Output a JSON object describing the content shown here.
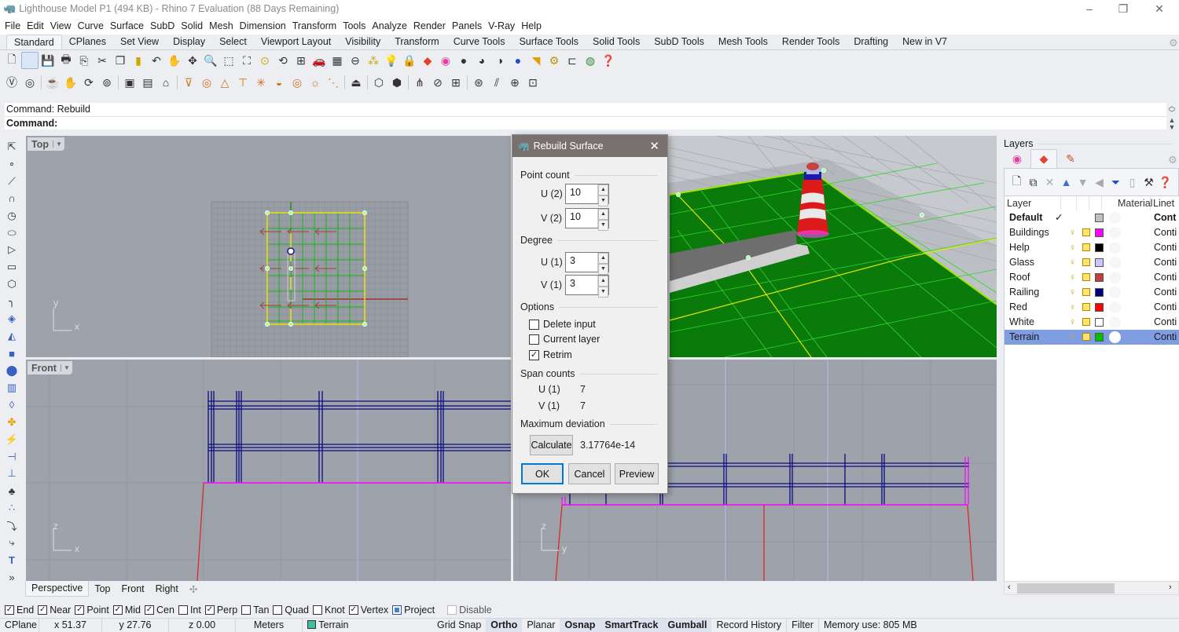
{
  "window": {
    "title": "Lighthouse Model P1 (494 KB) - Rhino 7 Evaluation (88 Days Remaining)",
    "minimize": "–",
    "restore": "❐",
    "close": "✕"
  },
  "menu": [
    "File",
    "Edit",
    "View",
    "Curve",
    "Surface",
    "SubD",
    "Solid",
    "Mesh",
    "Dimension",
    "Transform",
    "Tools",
    "Analyze",
    "Render",
    "Panels",
    "V-Ray",
    "Help"
  ],
  "toolbar_tabs": [
    "Standard",
    "CPlanes",
    "Set View",
    "Display",
    "Select",
    "Viewport Layout",
    "Visibility",
    "Transform",
    "Curve Tools",
    "Surface Tools",
    "Solid Tools",
    "SubD Tools",
    "Mesh Tools",
    "Render Tools",
    "Drafting",
    "New in V7"
  ],
  "active_toolbar_tab": "Standard",
  "command": {
    "history": "Command: Rebuild",
    "prompt": "Command:"
  },
  "viewports": {
    "top": {
      "label": "Top",
      "axes": [
        "y",
        "x"
      ]
    },
    "perspective": {
      "label": "Perspective"
    },
    "front": {
      "label": "Front",
      "axes": [
        "z",
        "x"
      ]
    },
    "right": {
      "label": "Right",
      "axes": [
        "z",
        "y"
      ]
    }
  },
  "viewport_tabs": [
    "Perspective",
    "Top",
    "Front",
    "Right"
  ],
  "active_viewport_tab": "Perspective",
  "dialog": {
    "title": "Rebuild Surface",
    "point_count": {
      "label": "Point count",
      "u_label": "U (2)",
      "u_value": "10",
      "v_label": "V (2)",
      "v_value": "10"
    },
    "degree": {
      "label": "Degree",
      "u_label": "U (1)",
      "u_value": "3",
      "v_label": "V (1)",
      "v_value": "3"
    },
    "options": {
      "label": "Options",
      "items": [
        {
          "label": "Delete input",
          "checked": false
        },
        {
          "label": "Current layer",
          "checked": false
        },
        {
          "label": "Retrim",
          "checked": true
        }
      ]
    },
    "span_counts": {
      "label": "Span counts",
      "u_label": "U (1)",
      "u_value": "7",
      "v_label": "V (1)",
      "v_value": "7"
    },
    "max_deviation": {
      "label": "Maximum deviation",
      "calculate": "Calculate",
      "value": "3.17764e-14"
    },
    "buttons": {
      "ok": "OK",
      "cancel": "Cancel",
      "preview": "Preview"
    }
  },
  "layers_panel": {
    "title": "Layers",
    "columns": [
      "Layer",
      "Material",
      "Linet"
    ],
    "rows": [
      {
        "name": "Default",
        "current": true,
        "color": "#c0c0c0",
        "linetype": "Cont",
        "bold": true
      },
      {
        "name": "Buildings",
        "color": "#ff00ff",
        "linetype": "Conti"
      },
      {
        "name": "Help",
        "color": "#000000",
        "linetype": "Conti"
      },
      {
        "name": "Glass",
        "color": "#c8c8ff",
        "linetype": "Conti"
      },
      {
        "name": "Roof",
        "color": "#c04040",
        "linetype": "Conti"
      },
      {
        "name": "Railing",
        "color": "#00007f",
        "linetype": "Conti"
      },
      {
        "name": "Red",
        "color": "#ff0000",
        "linetype": "Conti"
      },
      {
        "name": "White",
        "color": "#ffffff",
        "linetype": "Conti"
      },
      {
        "name": "Terrain",
        "color": "#00c000",
        "linetype": "Conti",
        "selected": true
      }
    ],
    "current_mark": "✓"
  },
  "osnap": [
    {
      "label": "End",
      "checked": true
    },
    {
      "label": "Near",
      "checked": true
    },
    {
      "label": "Point",
      "checked": true
    },
    {
      "label": "Mid",
      "checked": true
    },
    {
      "label": "Cen",
      "checked": true
    },
    {
      "label": "Int",
      "checked": false
    },
    {
      "label": "Perp",
      "checked": true
    },
    {
      "label": "Tan",
      "checked": false
    },
    {
      "label": "Quad",
      "checked": false
    },
    {
      "label": "Knot",
      "checked": false
    },
    {
      "label": "Vertex",
      "checked": true
    },
    {
      "label": "Project",
      "checked": true,
      "style": "project"
    },
    {
      "label": "Disable",
      "checked": false,
      "style": "disabled"
    }
  ],
  "status": {
    "cplane": "CPlane",
    "x": "x 51.37",
    "y": "y 27.76",
    "z": "z 0.00",
    "units": "Meters",
    "layer": "Terrain",
    "layer_color": "#3fbfa0",
    "toggles": [
      {
        "label": "Grid Snap",
        "on": false
      },
      {
        "label": "Ortho",
        "on": true
      },
      {
        "label": "Planar",
        "on": false
      },
      {
        "label": "Osnap",
        "on": true
      },
      {
        "label": "SmartTrack",
        "on": true
      },
      {
        "label": "Gumball",
        "on": true
      },
      {
        "label": "Record History",
        "on": false
      },
      {
        "label": "Filter",
        "on": false
      }
    ],
    "memory": "Memory use: 805 MB"
  },
  "colors": {
    "terrain_green": "#0a7a0a",
    "selection_yellow": "#e6e600",
    "railing_blue": "#0a0a80",
    "buildings_magenta": "#ff00ff",
    "dialog_titlebar": "#787170",
    "viewport_bg": "#9ea3ab"
  }
}
